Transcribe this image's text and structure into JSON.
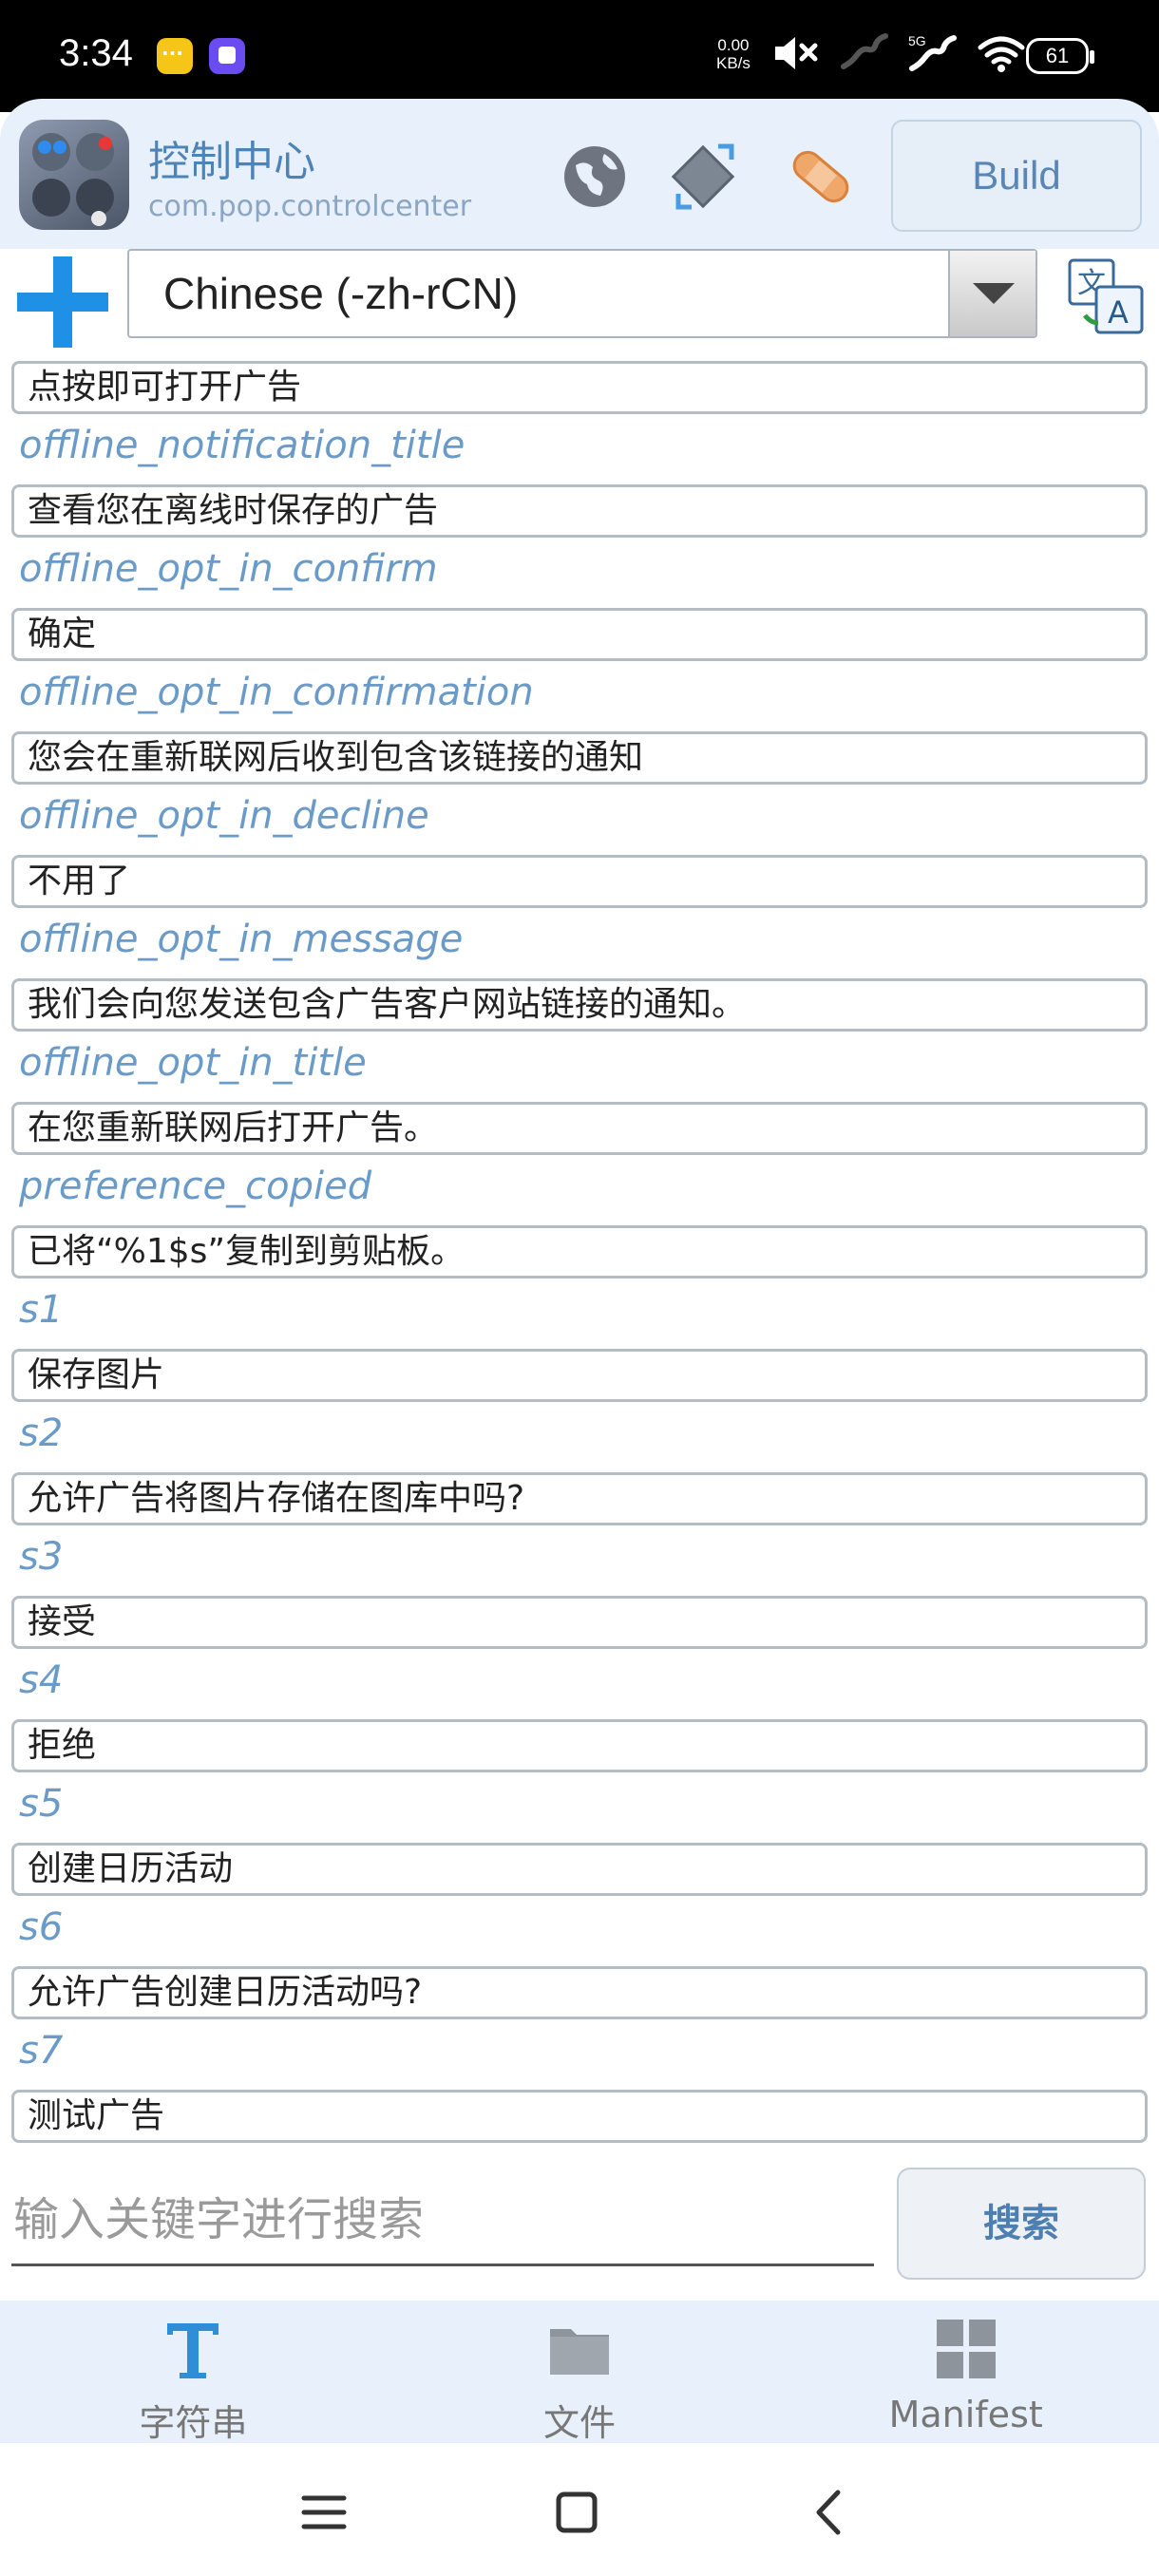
{
  "status_bar": {
    "time": "3:34",
    "net_speed_value": "0.00",
    "net_speed_unit": "KB/s",
    "battery": "61",
    "signal_label": "5G"
  },
  "header": {
    "app_title": "控制中心",
    "package_name": "com.pop.controlcenter",
    "build_label": "Build"
  },
  "language": {
    "selected": "Chinese (-zh-rCN)"
  },
  "strings": [
    {
      "key": "",
      "value": "点按即可打开广告"
    },
    {
      "key": "offline_notification_title",
      "value": "查看您在离线时保存的广告"
    },
    {
      "key": "offline_opt_in_confirm",
      "value": "确定"
    },
    {
      "key": "offline_opt_in_confirmation",
      "value": "您会在重新联网后收到包含该链接的通知"
    },
    {
      "key": "offline_opt_in_decline",
      "value": "不用了"
    },
    {
      "key": "offline_opt_in_message",
      "value": "我们会向您发送包含广告客户网站链接的通知。"
    },
    {
      "key": "offline_opt_in_title",
      "value": "在您重新联网后打开广告。"
    },
    {
      "key": "preference_copied",
      "value": "已将“%1$s”复制到剪贴板。"
    },
    {
      "key": "s1",
      "value": "保存图片"
    },
    {
      "key": "s2",
      "value": "允许广告将图片存储在图库中吗?"
    },
    {
      "key": "s3",
      "value": "接受"
    },
    {
      "key": "s4",
      "value": "拒绝"
    },
    {
      "key": "s5",
      "value": "创建日历活动"
    },
    {
      "key": "s6",
      "value": "允许广告创建日历活动吗?"
    },
    {
      "key": "s7",
      "value": "测试广告"
    }
  ],
  "search": {
    "placeholder": "输入关键字进行搜索",
    "button_label": "搜索"
  },
  "tabs": [
    {
      "label": "字符串",
      "icon": "text-t-icon"
    },
    {
      "label": "文件",
      "icon": "folder-icon"
    },
    {
      "label": "Manifest",
      "icon": "grid-icon"
    }
  ],
  "colors": {
    "accent": "#1e90e6",
    "key_text": "#6a9bc8",
    "header_bg": "#e8f0fb"
  }
}
